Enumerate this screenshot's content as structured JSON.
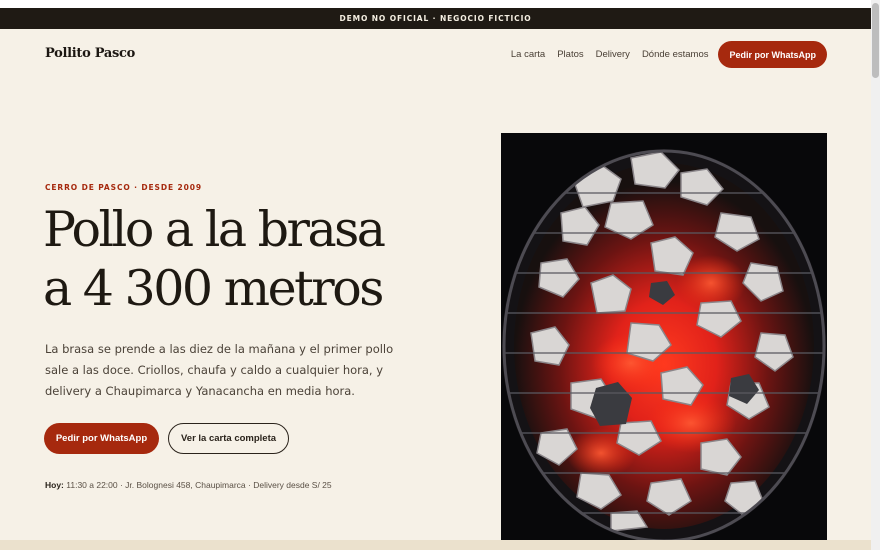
{
  "banner": "DEMO NO OFICIAL · NEGOCIO FICTICIO",
  "nav": {
    "brand": "Pollito Pasco",
    "links": [
      "La carta",
      "Platos",
      "Delivery",
      "Dónde estamos"
    ],
    "cta": "Pedir por WhatsApp"
  },
  "hero": {
    "eyebrow": "CERRO DE PASCO · DESDE 2009",
    "headline_line1": "Pollo a la brasa",
    "headline_line2": "a 4 300 metros",
    "lead": "La brasa se prende a las diez de la mañana y el primer pollo sale a las doce. Criollos, chaufa y caldo a cualquier hora, y delivery a Chaupimarca y Yanacancha en media hora.",
    "primary_button": "Pedir por WhatsApp",
    "secondary_button": "Ver la carta completa",
    "hours_label": "Hoy:",
    "hours_text": " 11:30 a 22:00 · Jr. Bolognesi 458, Chaupimarca · Delivery desde S/ 25"
  },
  "colors": {
    "accent": "#a6290e",
    "background": "#f6f1e7",
    "ink": "#1e1912",
    "banner_bg": "#1f1a14"
  },
  "image": {
    "subject": "glowing-charcoal-grill-photo"
  }
}
